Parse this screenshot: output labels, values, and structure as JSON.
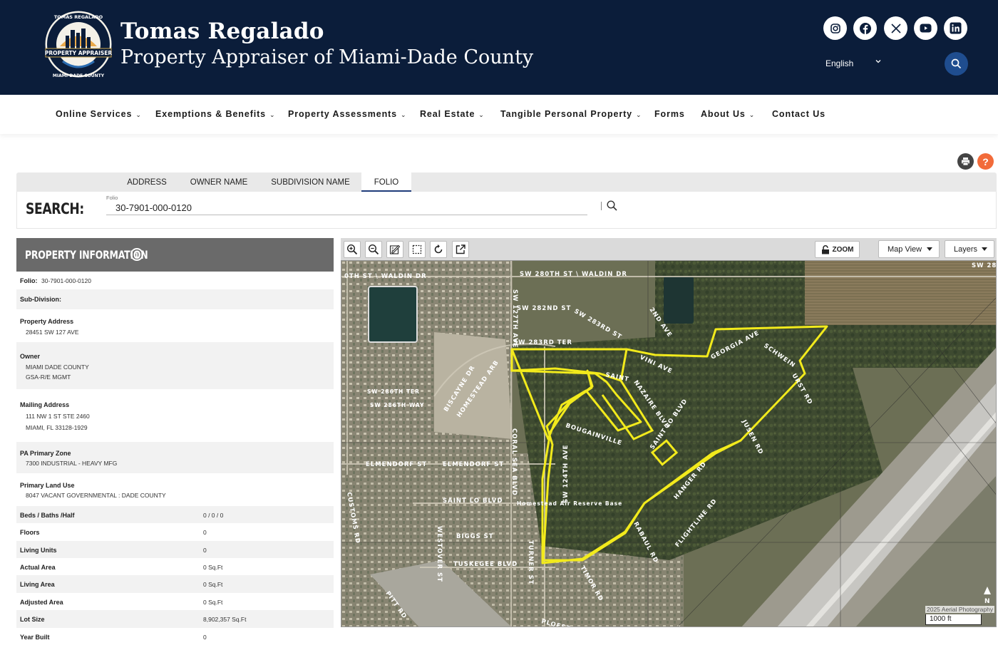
{
  "header": {
    "title": "Tomas Regalado",
    "subtitle": "Property Appraiser of Miami-Dade County",
    "logo_text_top": "TOMAS REGALADO",
    "logo_text_band": "PROPERTY APPRAISER",
    "logo_text_bottom": "MIAMI-DADE COUNTY",
    "social_icons": [
      "instagram-icon",
      "facebook-icon",
      "x-icon",
      "youtube-icon",
      "linkedin-icon"
    ],
    "language": "English",
    "colors": {
      "header_bg": "#0b1d3a",
      "accent": "#1f4d8f"
    }
  },
  "nav": {
    "items": [
      {
        "label": "Online Services",
        "has_menu": true
      },
      {
        "label": "Exemptions & Benefits",
        "has_menu": true
      },
      {
        "label": "Property Assessments",
        "has_menu": true
      },
      {
        "label": "Real Estate",
        "has_menu": true
      },
      {
        "label": "Tangible Personal Property",
        "has_menu": true
      },
      {
        "label": "Forms",
        "has_menu": false
      },
      {
        "label": "About Us",
        "has_menu": true
      },
      {
        "label": "Contact Us",
        "has_menu": false
      }
    ]
  },
  "search": {
    "tabs": [
      "ADDRESS",
      "OWNER NAME",
      "SUBDIVISION NAME",
      "FOLIO"
    ],
    "active_tab": "FOLIO",
    "label": "SEARCH:",
    "field_label": "Folio",
    "value": "30-7901-000-0120"
  },
  "property_info": {
    "title": "PROPERTY INFORMATION",
    "folio_label": "Folio:",
    "folio_value": "30-7901-000-0120",
    "subdivision_label": "Sub-Division:",
    "address_label": "Property Address",
    "address_value": "28451 SW 127 AVE",
    "owner_label": "Owner",
    "owner_line1": "MIAMI DADE COUNTY",
    "owner_line2": "GSA-R/E MGMT",
    "mailing_label": "Mailing Address",
    "mailing_line1": "111 NW 1 ST STE 2460",
    "mailing_line2": "MIAMI, FL 33128-1929",
    "zone_label": "PA Primary Zone",
    "zone_value": "7300 INDUSTRIAL - HEAVY MFG",
    "land_use_label": "Primary Land Use",
    "land_use_value": "8047 VACANT GOVERNMENTAL : DADE COUNTY",
    "stats": [
      {
        "label": "Beds / Baths /Half",
        "value": "0 / 0 / 0"
      },
      {
        "label": "Floors",
        "value": "0"
      },
      {
        "label": "Living Units",
        "value": "0"
      },
      {
        "label": "Actual Area",
        "value": "0 Sq.Ft"
      },
      {
        "label": "Living Area",
        "value": "0 Sq.Ft"
      },
      {
        "label": "Adjusted Area",
        "value": "0 Sq.Ft"
      },
      {
        "label": "Lot Size",
        "value": "8,902,357 Sq.Ft"
      },
      {
        "label": "Year Built",
        "value": "0"
      }
    ]
  },
  "map": {
    "toolbar": {
      "tools": [
        "zoom-in-icon",
        "zoom-out-icon",
        "measure-icon",
        "select-icon",
        "refresh-icon",
        "external-link-icon"
      ],
      "zoom_label": "ZOOM",
      "view_select": "Map View",
      "layers_select": "Layers"
    },
    "credit": "2025 Aerial Photography",
    "scale": "1000 ft",
    "north": "N",
    "parcel_outline_color": "#f2ea1c",
    "street_labels": [
      "SW 280TH ST \\ WALDIN DR",
      "0TH ST \\ WALDIN DR",
      "SW 282ND ST",
      "SW 283RD ST",
      "SW 283RD TER",
      "2ND AVE",
      "GEORGIA AVE",
      "SCHWEIN",
      "URST RD",
      "SAINT",
      "NAZAIRE BLVD",
      "SAINT LO BLVD",
      "BOUGAINVILLE",
      "VINI AVE",
      "ELMENDORF ST",
      "ELMENDORF ST",
      "SAINT LO BLVD",
      "HOMESTEAD ARB",
      "BISCAYNE DR",
      "SW 286TH TER",
      "SW 286TH WAY",
      "JUSEN RD",
      "HANGER RD",
      "FLIGHTLINE RD",
      "RABAUL RD",
      "BIGGS ST",
      "TUSKEGEE BLVD",
      "TIMOR RD",
      "PITT RD",
      "CUSTOMS RD",
      "WESTOVER ST",
      "TURNER ST",
      "CORAL SEA BLVD",
      "SW 124TH AVE",
      "SW 127TH AVE",
      "PLOESTI",
      "SW 28"
    ],
    "poi_label": "Homestead Air Reserve Base"
  }
}
